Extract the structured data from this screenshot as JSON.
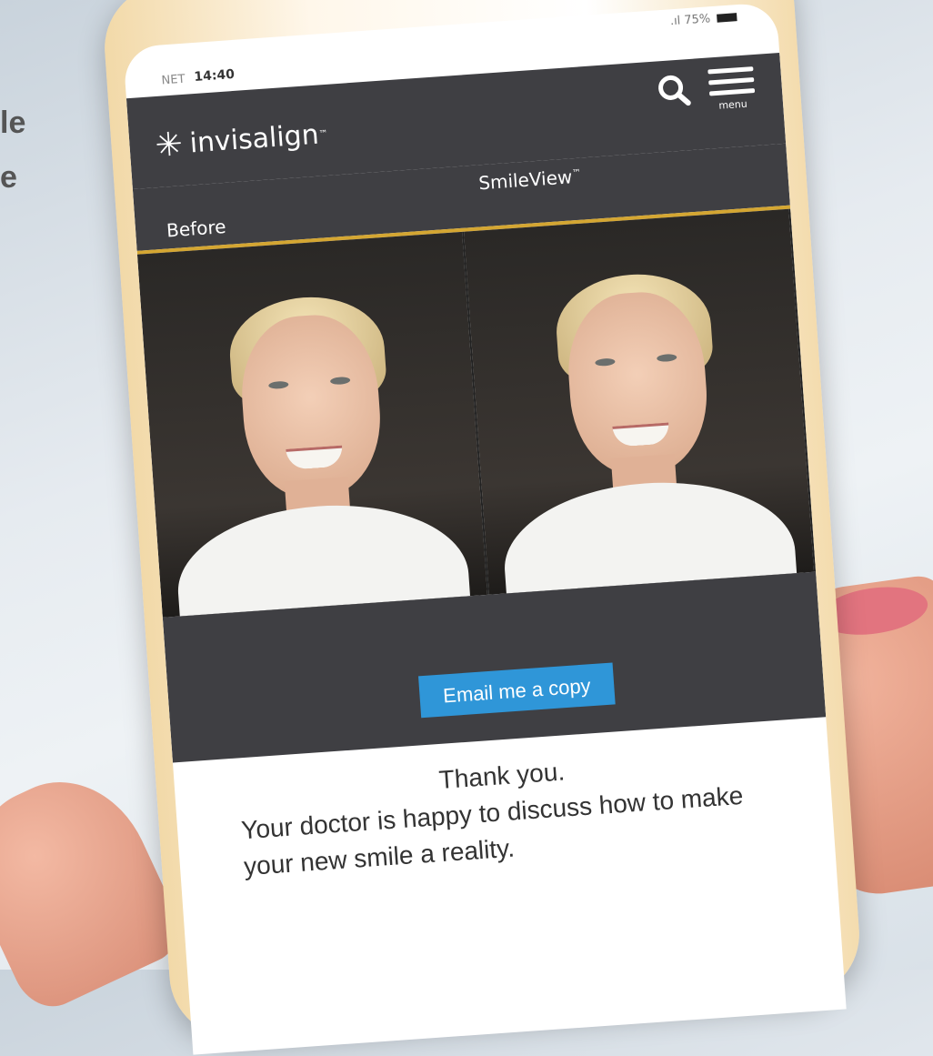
{
  "background": {
    "partial_text_lines": [
      "le",
      "e"
    ]
  },
  "status_bar": {
    "carrier": "NET",
    "time": "14:40",
    "signal": ".ıl",
    "battery_percent": "75%"
  },
  "header": {
    "brand": "invisalign",
    "brand_mark": "™",
    "menu_label": "menu"
  },
  "comparison": {
    "before_label": "Before",
    "after_label": "SmileView",
    "after_mark": "™"
  },
  "actions": {
    "email_button": "Email me a copy"
  },
  "message": {
    "line1": "Thank you.",
    "line2": "Your doctor is happy to discuss how to make",
    "line3": "your new smile a reality."
  },
  "colors": {
    "header_bg": "#3f3f43",
    "accent_gold": "#d4a632",
    "button_blue": "#2f96d8"
  }
}
